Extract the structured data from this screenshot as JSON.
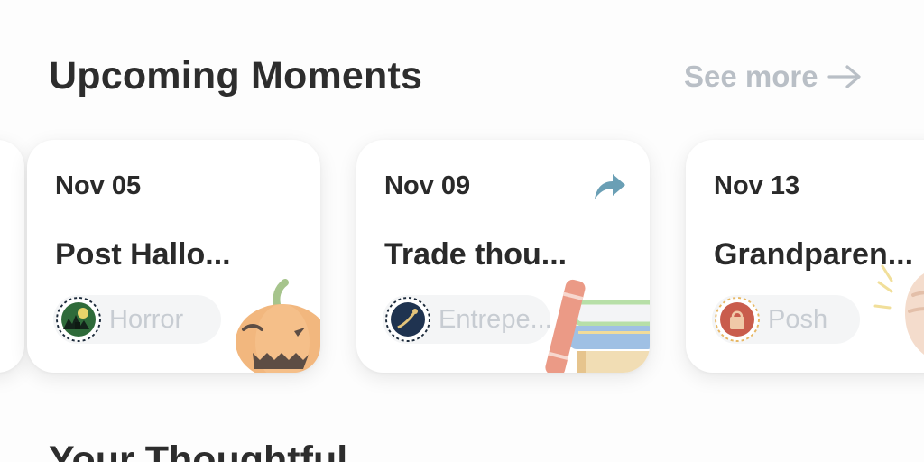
{
  "header": {
    "title": "Upcoming Moments",
    "see_more_label": "See more"
  },
  "cards": [
    {
      "date": "Nov 05",
      "title": "Post Hallo...",
      "chip_label": "Horror",
      "illustration": "pumpkin"
    },
    {
      "date": "Nov 09",
      "title": "Trade thou...",
      "chip_label": "Entrepe...",
      "illustration": "books",
      "share": true
    },
    {
      "date": "Nov 13",
      "title": "Grandparen...",
      "chip_label": "Posh",
      "illustration": "clapping-hands"
    }
  ],
  "section2": {
    "title": "Your Thoughtful"
  },
  "icons": {
    "see_more": "arrow-right-icon",
    "share": "share-arrow-icon"
  },
  "colors": {
    "accent_share": "#6a9fb5",
    "muted_text": "#b9bfc6",
    "chip_bg": "#f4f5f6"
  }
}
